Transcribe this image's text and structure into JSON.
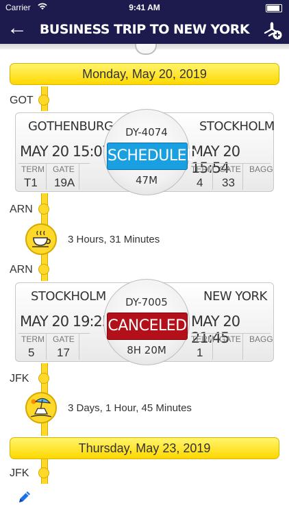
{
  "status_bar": {
    "carrier": "Carrier",
    "time": "9:41 AM"
  },
  "nav": {
    "back_icon": "arrow-left-icon",
    "title": "BUSINESS TRIP TO NEW YORK",
    "action_icon": "add-flight-icon"
  },
  "timeline": {
    "start_date": "Monday, May 20, 2019",
    "end_date": "Thursday, May 23, 2019",
    "airports": {
      "got": "GOT",
      "arn1": "ARN",
      "arn2": "ARN",
      "jfk1": "JFK",
      "jfk2": "JFK"
    }
  },
  "flights": [
    {
      "from_city": "GOTHENBURG",
      "to_city": "STOCKHOLM",
      "flight_no": "DY-4074",
      "status": "SCHEDULED",
      "duration": "47M",
      "dep_datetime": "MAY 20 15:07",
      "arr_datetime": "MAY 20 15:54",
      "labels": {
        "term": "TERM",
        "gate": "GATE",
        "bagg": "BAGG"
      },
      "dep_term": "T1",
      "dep_gate": "19A",
      "arr_term": "4",
      "arr_gate": "33",
      "arr_bagg": ""
    },
    {
      "from_city": "STOCKHOLM",
      "to_city": "NEW YORK",
      "flight_no": "DY-7005",
      "status": "CANCELED",
      "duration": "8H 20M",
      "dep_datetime": "MAY 20 19:25",
      "arr_datetime": "MAY 20 21:45",
      "labels": {
        "term": "TERM",
        "gate": "GATE",
        "bagg": "BAGG"
      },
      "dep_term": "5",
      "dep_gate": "17",
      "arr_term": "1",
      "arr_gate": "",
      "arr_bagg": ""
    }
  ],
  "layovers": [
    {
      "icon": "coffee-cup-icon",
      "text": "3 Hours, 31 Minutes"
    },
    {
      "icon": "beach-umbrella-icon",
      "text": "3 Days, 1 Hour, 45 Minutes"
    }
  ],
  "edit_icon": "pencil-icon",
  "colors": {
    "nav": "#1d1b4e",
    "timeline_yellow": "#ffd92a",
    "scheduled": "#1a9fe0",
    "canceled": "#b4101a"
  }
}
